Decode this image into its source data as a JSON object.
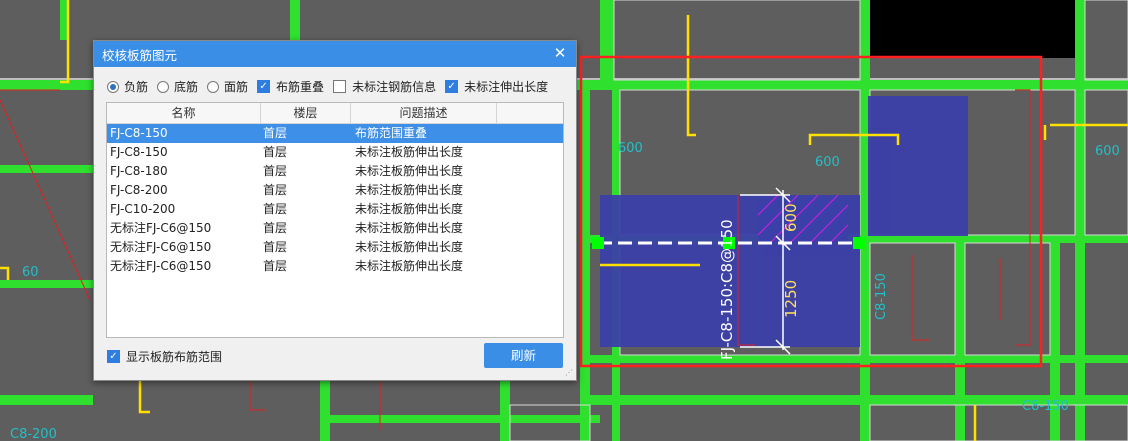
{
  "dialog": {
    "title": "校核板筋图元",
    "close_glyph": "✕",
    "options": {
      "negative_label": "负筋",
      "bottom_label": "底筋",
      "top_label": "面筋",
      "overlap_label": "布筋重叠",
      "unlabeled_info_label": "未标注钢筋信息",
      "unlabeled_length_label": "未标注伸出长度"
    },
    "columns": [
      "名称",
      "楼层",
      "问题描述"
    ],
    "rows": [
      {
        "name": "FJ-C8-150",
        "floor": "首层",
        "desc": "布筋范围重叠"
      },
      {
        "name": "FJ-C8-150",
        "floor": "首层",
        "desc": "未标注板筋伸出长度"
      },
      {
        "name": "FJ-C8-180",
        "floor": "首层",
        "desc": "未标注板筋伸出长度"
      },
      {
        "name": "FJ-C8-200",
        "floor": "首层",
        "desc": "未标注板筋伸出长度"
      },
      {
        "name": "FJ-C10-200",
        "floor": "首层",
        "desc": "未标注板筋伸出长度"
      },
      {
        "name": "无标注FJ-C6@150",
        "floor": "首层",
        "desc": "未标注板筋伸出长度"
      },
      {
        "name": "无标注FJ-C6@150",
        "floor": "首层",
        "desc": "未标注板筋伸出长度"
      },
      {
        "name": "无标注FJ-C6@150",
        "floor": "首层",
        "desc": "未标注板筋伸出长度"
      }
    ],
    "show_range_label": "显示板筋布筋范围",
    "refresh_label": "刷新",
    "check_glyph": "✓"
  },
  "cad": {
    "labels": {
      "main_rebar": "FJ-C8-150:C8@150",
      "dim_600": "600",
      "dim_1250": "1250",
      "c8_150_a": "C8-150",
      "c8_150_b": "C8-150",
      "n60": "60",
      "n600a": "600",
      "n600b": "600",
      "n600c": "600",
      "n200": "C8-200"
    },
    "colors": {
      "background": "#5e5e5e",
      "beam": "#2fe02f",
      "slab_blue": "#3b3fa8",
      "highlight": "#ff2020",
      "rebar": "#ffe000",
      "select": "#00ff00"
    }
  }
}
